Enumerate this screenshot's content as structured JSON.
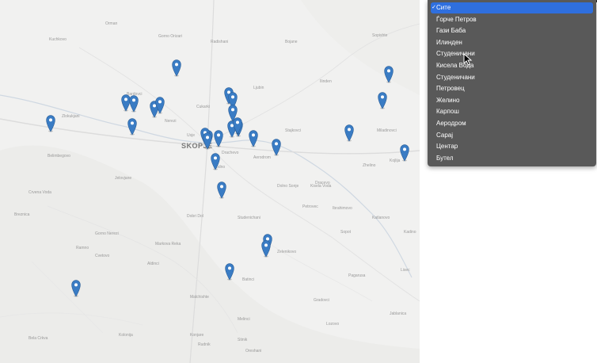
{
  "map": {
    "city_label": "SKOPJE",
    "place_labels": [
      "Kuchkovo",
      "Orman",
      "Gorno Orizari",
      "Radishani",
      "Bojane",
      "Ljubin",
      "Cukarki",
      "Sopishte",
      "Bardovci",
      "Zlokukjani",
      "Nerezi",
      "Stajkovci",
      "Ilinden",
      "Miladinovci",
      "Aerodrom",
      "Vodno",
      "Dolno Sonje",
      "Kisela Voda",
      "Dracevo",
      "Studenichani",
      "Petrovec",
      "Sopot",
      "Katlanovo",
      "Ibrahimovo",
      "Kadino",
      "Crvena Voda",
      "Jelovjane",
      "Belimbegovo",
      "Breznica",
      "Dobri Dol",
      "Gorno Nerezi",
      "Markova Reka",
      "Zelenikovo",
      "Batinci",
      "Aldinci",
      "Pagarusa",
      "Lisec",
      "Malchishte",
      "Gradovci",
      "Jablanica",
      "Bela Crkva",
      "Kolonija",
      "Melinci",
      "Rudnik",
      "Stinik",
      "Oreshani",
      "Konjare",
      "Lozovo",
      "Cvetovo",
      "Ramno",
      "Drachevo",
      "Kojlija",
      "Zhelino",
      "Usje"
    ],
    "pin_count": 29
  },
  "dropdown": {
    "selected_index": 0,
    "options": [
      "Сите",
      "Ѓорче Петров",
      "Гази Баба",
      "Илинден",
      "Студеничани",
      "Кисела Вода",
      "Студеничани",
      "Петровец",
      "Желино",
      "Карпош",
      "Аеродром",
      "Сарај",
      "Центар",
      "Бутел"
    ]
  },
  "colors": {
    "pin": "#3a7cc4",
    "selected": "#2f6fde",
    "menu_bg": "#595959",
    "map_bg": "#f1f1f0"
  },
  "icons": {
    "pin": "map-pin-icon",
    "check": "checkmark-icon",
    "cursor": "cursor-arrow-icon"
  }
}
